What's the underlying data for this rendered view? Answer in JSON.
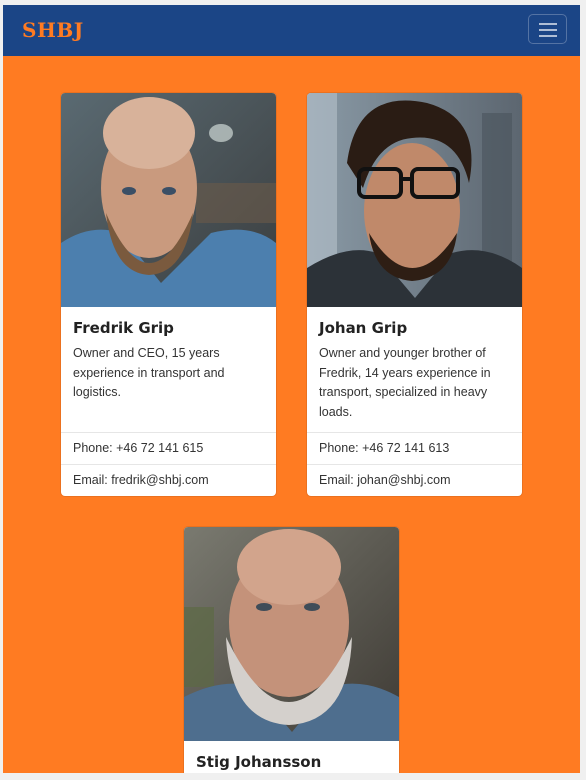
{
  "navbar": {
    "brand": "SHBJ"
  },
  "cards": [
    {
      "name": "Fredrik Grip",
      "description": "Owner and CEO, 15 years experience in transport and logistics.",
      "phone": "Phone: +46 72 141 615",
      "email": "Email: fredrik@shbj.com"
    },
    {
      "name": "Johan Grip",
      "description": "Owner and younger brother of Fredrik, 14 years experience in transport, specialized in heavy loads.",
      "phone": "Phone: +46 72 141 613",
      "email": "Email: johan@shbj.com"
    },
    {
      "name": "Stig Johansson"
    }
  ]
}
